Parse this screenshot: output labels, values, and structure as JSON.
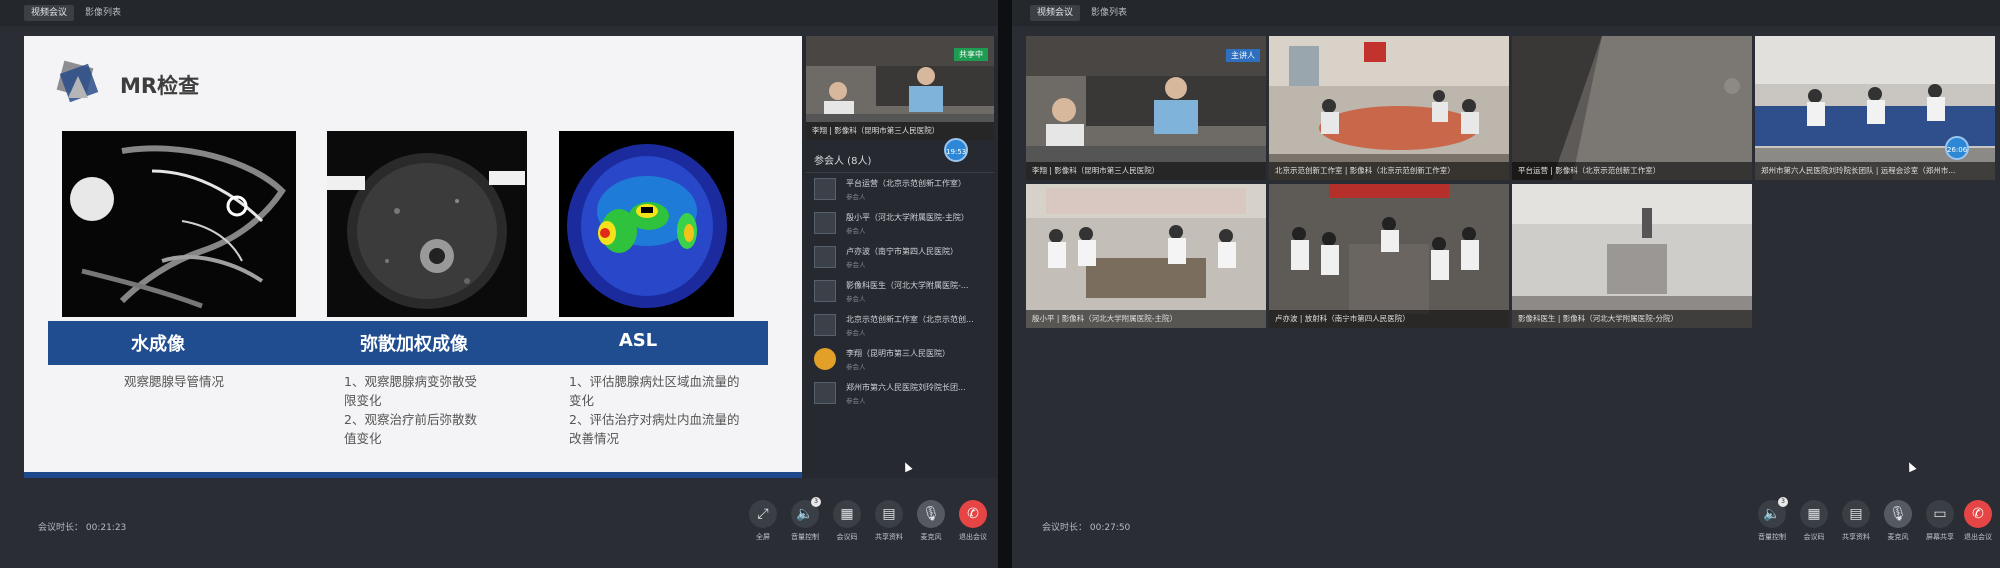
{
  "left": {
    "tabs": [
      {
        "label": "视频会议"
      },
      {
        "label": "影像列表"
      }
    ],
    "slide": {
      "title": "MR检查",
      "bands": [
        "水成像",
        "弥散加权成像",
        "ASL"
      ],
      "descs": [
        {
          "lines": [
            "观察腮腺导管情况"
          ]
        },
        {
          "lines": [
            "1、观察腮腺病变弥散受",
            "限变化",
            "2、观察治疗前后弥散数",
            "值变化"
          ]
        },
        {
          "lines": [
            "1、评估腮腺病灶区域血流量的",
            "变化",
            "2、评估治疗对病灶内血流量的",
            "改善情况"
          ]
        }
      ]
    },
    "speaker": {
      "caption": "李翔 | 影像科（昆明市第三人民医院）",
      "badge": "共享中",
      "timer": "19:53"
    },
    "participants_header": "参会人 (8人)",
    "participants": [
      {
        "name": "平台运营（北京示范创新工作室）",
        "role": "参会人"
      },
      {
        "name": "殷小平（河北大学附属医院-主院）",
        "role": "参会人"
      },
      {
        "name": "卢亦波（南宁市第四人民医院）",
        "role": "参会人"
      },
      {
        "name": "影像科医生（河北大学附属医院-...",
        "role": "参会人"
      },
      {
        "name": "北京示范创新工作室（北京示范创...",
        "role": "参会人"
      },
      {
        "name": "李翔（昆明市第三人民医院）",
        "role": "参会人"
      },
      {
        "name": "郑州市第六人民医院刘玲院长团...",
        "role": "参会人"
      }
    ],
    "duration": "会议时长：  00:21:23",
    "toolbar": [
      {
        "label": "全屏",
        "icon": "⤢"
      },
      {
        "label": "音量控制",
        "icon": "🔈",
        "badge": "3"
      },
      {
        "label": "会议码",
        "icon": "▦"
      },
      {
        "label": "共享资料",
        "icon": "▤"
      },
      {
        "label": "麦克风",
        "icon": "🎙"
      },
      {
        "label": "退出会议",
        "icon": "✆"
      }
    ]
  },
  "right": {
    "tabs": [
      {
        "label": "视频会议"
      },
      {
        "label": "影像列表"
      }
    ],
    "tiles": [
      {
        "caption": "李翔 | 影像科（昆明市第三人民医院）",
        "badge": "主讲人"
      },
      {
        "caption": "北京示范创新工作室 | 影像科（北京示范创新工作室）"
      },
      {
        "caption": "平台运营 | 影像科（北京示范创新工作室）"
      },
      {
        "caption": "郑州市第六人民医院刘玲院长团队 | 远程会诊室（郑州市...",
        "timer": "26:06"
      },
      {
        "caption": "殷小平 | 影像科（河北大学附属医院-主院）"
      },
      {
        "caption": "卢亦波 | 放射科（南宁市第四人民医院）"
      },
      {
        "caption": "影像科医生 | 影像科（河北大学附属医院-分院）"
      }
    ],
    "duration": "会议时长：  00:27:50",
    "toolbar": [
      {
        "label": "音量控制",
        "icon": "🔈",
        "badge": "3"
      },
      {
        "label": "会议码",
        "icon": "▦"
      },
      {
        "label": "共享资料",
        "icon": "▤"
      },
      {
        "label": "麦克风",
        "icon": "🎙"
      },
      {
        "label": "屏幕共享",
        "icon": "▭"
      },
      {
        "label": "退出会议",
        "icon": "✆"
      }
    ]
  },
  "colors": {
    "accent_blue": "#1f4d8f",
    "share_green": "#1e9c52",
    "exit_red": "#e54545"
  }
}
